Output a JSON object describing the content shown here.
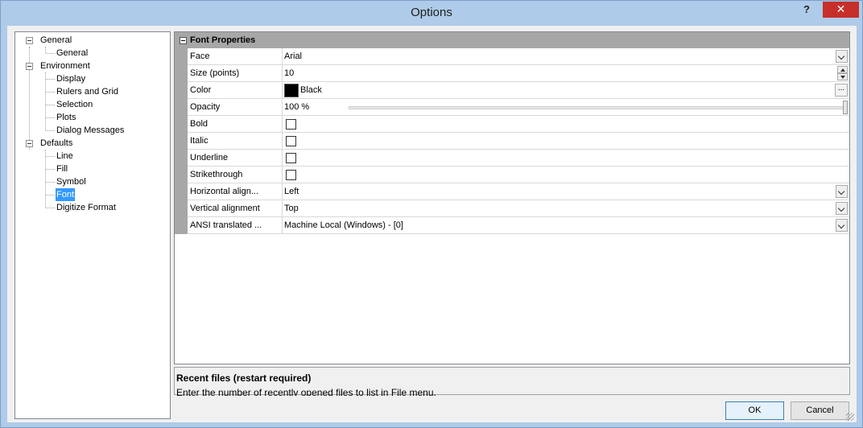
{
  "window": {
    "title": "Options",
    "help": "?",
    "close": "✕"
  },
  "tree": {
    "nodes": [
      {
        "label": "General",
        "level": 0,
        "expanded": true
      },
      {
        "label": "General",
        "level": 1
      },
      {
        "label": "Environment",
        "level": 0,
        "expanded": true
      },
      {
        "label": "Display",
        "level": 1
      },
      {
        "label": "Rulers and Grid",
        "level": 1
      },
      {
        "label": "Selection",
        "level": 1
      },
      {
        "label": "Plots",
        "level": 1
      },
      {
        "label": "Dialog Messages",
        "level": 1
      },
      {
        "label": "Defaults",
        "level": 0,
        "expanded": true
      },
      {
        "label": "Line",
        "level": 1
      },
      {
        "label": "Fill",
        "level": 1
      },
      {
        "label": "Symbol",
        "level": 1
      },
      {
        "label": "Font",
        "level": 1,
        "selected": true
      },
      {
        "label": "Digitize Format",
        "level": 1
      }
    ]
  },
  "grid": {
    "category": "Font Properties",
    "props": {
      "face": {
        "name": "Face",
        "value": "Arial"
      },
      "size": {
        "name": "Size (points)",
        "value": "10"
      },
      "color": {
        "name": "Color",
        "value": "Black",
        "ellipsis": "...",
        "swatch": "#000000"
      },
      "opacity": {
        "name": "Opacity",
        "value": "100 %",
        "slider_fraction": 1.0
      },
      "bold": {
        "name": "Bold"
      },
      "italic": {
        "name": "Italic"
      },
      "underline": {
        "name": "Underline"
      },
      "strikethrough": {
        "name": "Strikethrough"
      },
      "halign": {
        "name": "Horizontal align...",
        "value": "Left"
      },
      "valign": {
        "name": "Vertical alignment",
        "value": "Top"
      },
      "ansi": {
        "name": "ANSI translated ...",
        "value": "Machine Local (Windows) - [0]"
      }
    }
  },
  "description": {
    "title": "Recent files (restart required)",
    "text": "Enter the number of recently opened files to list in File menu."
  },
  "buttons": {
    "ok": "OK",
    "cancel": "Cancel"
  }
}
